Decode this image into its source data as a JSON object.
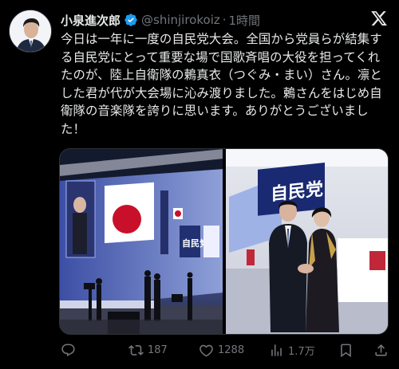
{
  "author": {
    "display_name": "小泉進次郎",
    "handle": "@shinjirokoiz",
    "separator": "·",
    "time": "1時間"
  },
  "tweet": {
    "text": "今日は一年に一度の自民党大会。全国から党員らが結集する自民党にとって重要な場で国歌斉唱の大役を担ってくれたのが、陸上自衛隊の鶫真衣（つぐみ・まい）さん。凛とした君が代が大会場に沁み渡りました。鶫さんをはじめ自衛隊の音楽隊を誇りに思います。ありがとうございました！"
  },
  "media": {
    "left_banner_text": "自民党",
    "right_banner_text": "自民党"
  },
  "actions": {
    "reply_count": "",
    "retweet_count": "187",
    "like_count": "1288",
    "views_count": "1.7万"
  },
  "icons": {
    "verified": "verified-badge-icon",
    "platform": "x-logo-icon",
    "reply": "reply-icon",
    "retweet": "retweet-icon",
    "like": "heart-icon",
    "views": "views-icon",
    "bookmark": "bookmark-icon",
    "share": "share-icon"
  },
  "colors": {
    "background": "#000000",
    "text": "#e7e9ea",
    "muted": "#71767b",
    "verified": "#1d9bf0"
  }
}
